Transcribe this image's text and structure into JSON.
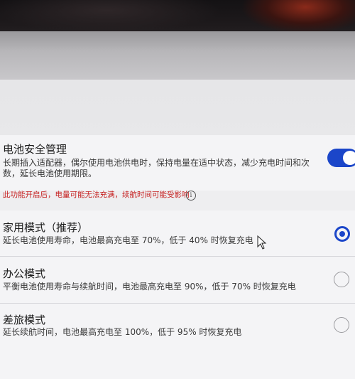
{
  "battery_management": {
    "title": "电池安全管理",
    "desc_line1": "长期插入适配器，偶尔使用电池供电时，保持电量在适中状态，减少充电时间和次",
    "desc_line2": "数，延长电池使用期限。",
    "enabled": true,
    "warning": "此功能开启后，电量可能无法充满，续航时间可能受影响"
  },
  "modes": [
    {
      "title": "家用模式（推荐）",
      "desc": "延长电池使用寿命，电池最高充电至 70%，低于 40% 时恢复充电",
      "selected": true
    },
    {
      "title": "办公模式",
      "desc": "平衡电池使用寿命与续航时间，电池最高充电至 90%，低于 70% 时恢复充电",
      "selected": false
    },
    {
      "title": "差旅模式",
      "desc": "延长续航时间，电池最高充电至 100%，低于 95% 时恢复充电",
      "selected": false
    }
  ],
  "icons": {
    "info": "info-icon",
    "cursor": "mouse-pointer-icon"
  },
  "colors": {
    "accent": "#1b46c9",
    "warning": "#c62020"
  }
}
